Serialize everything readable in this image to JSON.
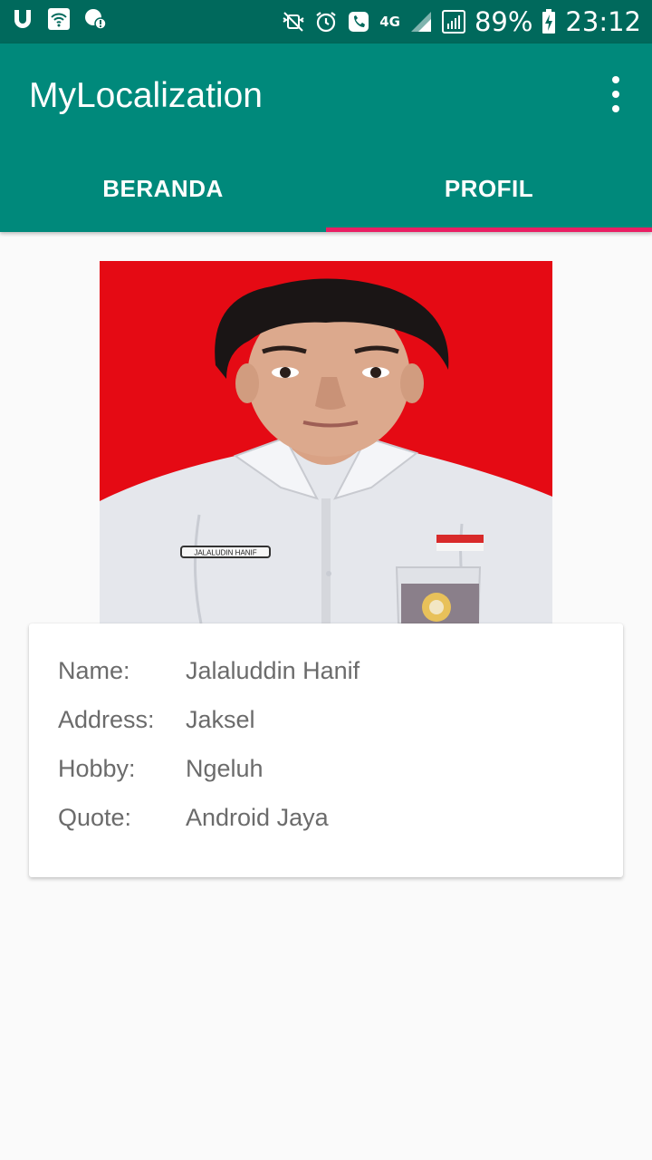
{
  "status_bar": {
    "battery": "89%",
    "time": "23:12",
    "network": "4G",
    "icons": [
      "u-icon",
      "wifi-icon",
      "chat-icon",
      "mute-icon",
      "alarm-icon",
      "call-icon",
      "signal-icon",
      "battery-charging-icon"
    ]
  },
  "app_bar": {
    "title": "MyLocalization"
  },
  "tabs": [
    {
      "label": "BERANDA",
      "active": false
    },
    {
      "label": "PROFIL",
      "active": true
    }
  ],
  "profile": {
    "name_tag": "JALALUDIN HANIF",
    "fields": [
      {
        "label": "Name:",
        "value": "Jalaluddin Hanif"
      },
      {
        "label": "Address:",
        "value": "Jaksel"
      },
      {
        "label": "Hobby:",
        "value": "Ngeluh"
      },
      {
        "label": "Quote:",
        "value": "Android Jaya"
      }
    ]
  },
  "colors": {
    "status_bar": "#00695c",
    "primary": "#00897b",
    "accent": "#e91e63",
    "photo_background": "#e50a14"
  }
}
